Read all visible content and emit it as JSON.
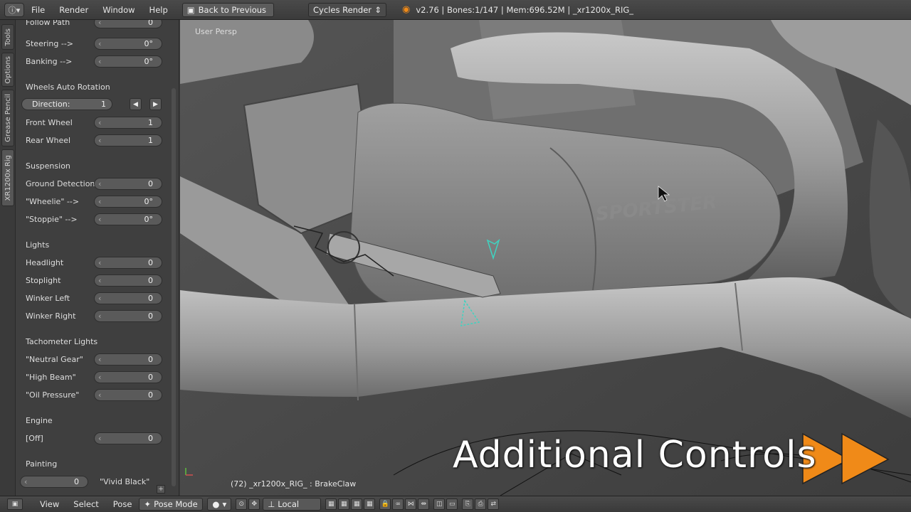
{
  "topbar": {
    "info_icon": "info-icon",
    "menus": [
      "File",
      "Render",
      "Window",
      "Help"
    ],
    "back_button": "Back to Previous",
    "render_engine": "Cycles Render",
    "stats": "v2.76 | Bones:1/147  | Mem:696.52M | _xr1200x_RIG_"
  },
  "tabs": [
    "Tools",
    "Options",
    "Grease Pencil",
    "XR1200x Rig"
  ],
  "panel": {
    "cut_top_label": "Follow Path",
    "steering": {
      "label": "Steering -->",
      "value": "0°"
    },
    "banking": {
      "label": "Banking -->",
      "value": "0°"
    },
    "wheels_section": "Wheels Auto Rotation",
    "direction": {
      "label": "Direction:",
      "value": "1"
    },
    "front_wheel": {
      "label": "Front Wheel",
      "value": "1"
    },
    "rear_wheel": {
      "label": "Rear Wheel",
      "value": "1"
    },
    "suspension_section": "Suspension",
    "ground_detection": {
      "label": "Ground Detection",
      "value": "0"
    },
    "wheelie": {
      "label": "\"Wheelie\" -->",
      "value": "0°"
    },
    "stoppie": {
      "label": "\"Stoppie\" -->",
      "value": "0°"
    },
    "lights_section": "Lights",
    "headlight": {
      "label": "Headlight",
      "value": "0"
    },
    "stoplight": {
      "label": "Stoplight",
      "value": "0"
    },
    "winker_left": {
      "label": "Winker Left",
      "value": "0"
    },
    "winker_right": {
      "label": "Winker Right",
      "value": "0"
    },
    "tacho_section": "Tachometer Lights",
    "neutral_gear": {
      "label": "\"Neutral Gear\"",
      "value": "0"
    },
    "high_beam": {
      "label": "\"High Beam\"",
      "value": "0"
    },
    "oil_pressure": {
      "label": "\"Oil Pressure\"",
      "value": "0"
    },
    "engine_section": "Engine",
    "engine_off": {
      "label": "[Off]",
      "value": "0"
    },
    "painting_section": "Painting",
    "painting": {
      "value": "0",
      "name": "\"Vivid Black\""
    }
  },
  "viewport": {
    "view_label": "User Persp",
    "status": "(72) _xr1200x_RIG_ : BrakeClaw",
    "overlay_title": "Additional Controls"
  },
  "bottombar": {
    "menus": [
      "View",
      "Select",
      "Pose"
    ],
    "mode": "Pose Mode",
    "pivot": "Local"
  },
  "colors": {
    "overlay_arrow": "#f08a18",
    "bone_highlight": "#3fd3c0"
  }
}
